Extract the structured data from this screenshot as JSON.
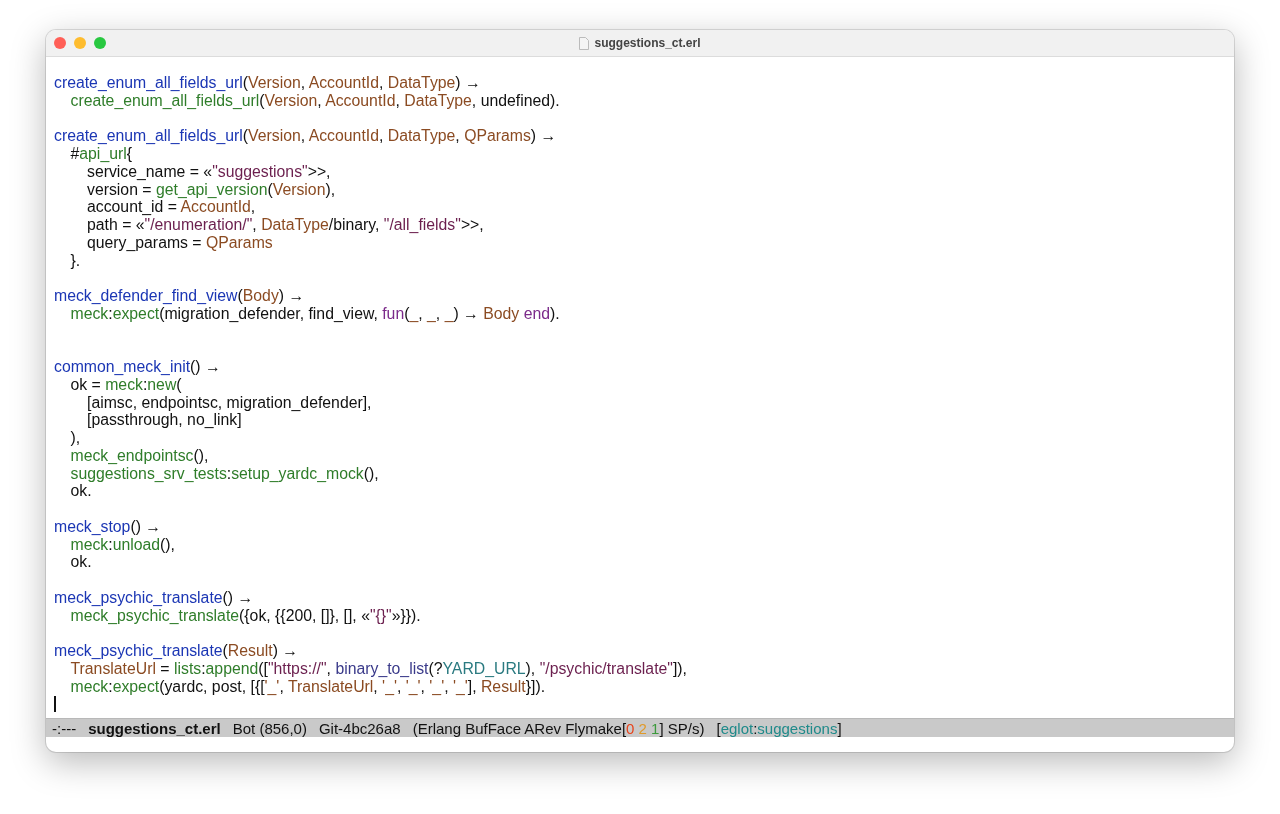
{
  "window": {
    "title": "suggestions_ct.erl"
  },
  "lines": [
    {
      "kind": "code",
      "tokens": [
        {
          "text": "create_enum_all_fields_url",
          "kind": "def"
        },
        {
          "text": "(",
          "kind": "p"
        },
        {
          "text": "Version",
          "kind": "var"
        },
        {
          "text": ", ",
          "kind": "p"
        },
        {
          "text": "AccountId",
          "kind": "var"
        },
        {
          "text": ", ",
          "kind": "p"
        },
        {
          "text": "DataType",
          "kind": "var"
        },
        {
          "text": ") →",
          "kind": "p"
        }
      ],
      "children": [
        {
          "kind": "code",
          "tokens": [
            {
              "text": "create_enum_all_fields_url",
              "kind": "call"
            },
            {
              "text": "(",
              "kind": "p"
            },
            {
              "text": "Version",
              "kind": "var"
            },
            {
              "text": ", ",
              "kind": "p"
            },
            {
              "text": "AccountId",
              "kind": "var"
            },
            {
              "text": ", ",
              "kind": "p"
            },
            {
              "text": "DataType",
              "kind": "var"
            },
            {
              "text": ", undefined).",
              "kind": "p"
            }
          ]
        }
      ]
    },
    {
      "kind": "blank"
    },
    {
      "kind": "code",
      "tokens": [
        {
          "text": "create_enum_all_fields_url",
          "kind": "def"
        },
        {
          "text": "(",
          "kind": "p"
        },
        {
          "text": "Version",
          "kind": "var"
        },
        {
          "text": ", ",
          "kind": "p"
        },
        {
          "text": "AccountId",
          "kind": "var"
        },
        {
          "text": ", ",
          "kind": "p"
        },
        {
          "text": "DataType",
          "kind": "var"
        },
        {
          "text": ", ",
          "kind": "p"
        },
        {
          "text": "QParams",
          "kind": "var"
        },
        {
          "text": ") →",
          "kind": "p"
        }
      ],
      "children": [
        {
          "kind": "code",
          "tokens": [
            {
              "text": "#",
              "kind": "p"
            },
            {
              "text": "api_url",
              "kind": "call"
            },
            {
              "text": "{",
              "kind": "p"
            }
          ],
          "children": [
            {
              "kind": "code",
              "tokens": [
                {
                  "text": "service_name = «",
                  "kind": "p"
                },
                {
                  "text": "\"suggestions\"",
                  "kind": "str"
                },
                {
                  "text": ">>,",
                  "kind": "p"
                }
              ]
            },
            {
              "kind": "code",
              "tokens": [
                {
                  "text": "version = ",
                  "kind": "p"
                },
                {
                  "text": "get_api_version",
                  "kind": "call"
                },
                {
                  "text": "(",
                  "kind": "p"
                },
                {
                  "text": "Version",
                  "kind": "var"
                },
                {
                  "text": "),",
                  "kind": "p"
                }
              ]
            },
            {
              "kind": "code",
              "tokens": [
                {
                  "text": "account_id = ",
                  "kind": "p"
                },
                {
                  "text": "AccountId",
                  "kind": "var"
                },
                {
                  "text": ",",
                  "kind": "p"
                }
              ]
            },
            {
              "kind": "code",
              "tokens": [
                {
                  "text": "path = «",
                  "kind": "p"
                },
                {
                  "text": "\"/enumeration/\"",
                  "kind": "str"
                },
                {
                  "text": ", ",
                  "kind": "p"
                },
                {
                  "text": "DataType",
                  "kind": "var"
                },
                {
                  "text": "/binary, ",
                  "kind": "p"
                },
                {
                  "text": "\"/all_fields\"",
                  "kind": "str"
                },
                {
                  "text": ">>,",
                  "kind": "p"
                }
              ]
            },
            {
              "kind": "code",
              "tokens": [
                {
                  "text": "query_params = ",
                  "kind": "p"
                },
                {
                  "text": "QParams",
                  "kind": "var"
                }
              ]
            }
          ]
        },
        {
          "kind": "code",
          "tokens": [
            {
              "text": "}.",
              "kind": "p"
            }
          ]
        }
      ]
    },
    {
      "kind": "blank"
    },
    {
      "kind": "code",
      "tokens": [
        {
          "text": "meck_defender_find_view",
          "kind": "def"
        },
        {
          "text": "(",
          "kind": "p"
        },
        {
          "text": "Body",
          "kind": "var"
        },
        {
          "text": ") →",
          "kind": "p"
        }
      ],
      "children": [
        {
          "kind": "code",
          "tokens": [
            {
              "text": "meck",
              "kind": "call"
            },
            {
              "text": ":",
              "kind": "p"
            },
            {
              "text": "expect",
              "kind": "call"
            },
            {
              "text": "(migration_defender, find_view, ",
              "kind": "p"
            },
            {
              "text": "fun",
              "kind": "kw"
            },
            {
              "text": "(",
              "kind": "p"
            },
            {
              "text": "_",
              "kind": "var"
            },
            {
              "text": ", ",
              "kind": "p"
            },
            {
              "text": "_",
              "kind": "var"
            },
            {
              "text": ", ",
              "kind": "p"
            },
            {
              "text": "_",
              "kind": "var"
            },
            {
              "text": ") → ",
              "kind": "p"
            },
            {
              "text": "Body ",
              "kind": "var"
            },
            {
              "text": "end",
              "kind": "kw"
            },
            {
              "text": ").",
              "kind": "p"
            }
          ]
        }
      ]
    },
    {
      "kind": "blank"
    },
    {
      "kind": "blank"
    },
    {
      "kind": "code",
      "tokens": [
        {
          "text": "common_meck_init",
          "kind": "def"
        },
        {
          "text": "() →",
          "kind": "p"
        }
      ],
      "children": [
        {
          "kind": "code",
          "tokens": [
            {
              "text": "ok = ",
              "kind": "p"
            },
            {
              "text": "meck",
              "kind": "call"
            },
            {
              "text": ":",
              "kind": "p"
            },
            {
              "text": "new",
              "kind": "call"
            },
            {
              "text": "(",
              "kind": "p"
            }
          ],
          "children": [
            {
              "kind": "code",
              "tokens": [
                {
                  "text": "[aimsc, endpointsc, migration_defender],",
                  "kind": "p"
                }
              ]
            },
            {
              "kind": "code",
              "tokens": [
                {
                  "text": "[passthrough, no_link]",
                  "kind": "p"
                }
              ]
            }
          ]
        },
        {
          "kind": "code",
          "tokens": [
            {
              "text": "),",
              "kind": "p"
            }
          ]
        },
        {
          "kind": "code",
          "tokens": [
            {
              "text": "meck_endpointsc",
              "kind": "call"
            },
            {
              "text": "(),",
              "kind": "p"
            }
          ]
        },
        {
          "kind": "code",
          "tokens": [
            {
              "text": "suggestions_srv_tests",
              "kind": "call"
            },
            {
              "text": ":",
              "kind": "p"
            },
            {
              "text": "setup_yardc_mock",
              "kind": "call"
            },
            {
              "text": "(),",
              "kind": "p"
            }
          ]
        },
        {
          "kind": "code",
          "tokens": [
            {
              "text": "ok.",
              "kind": "p"
            }
          ]
        }
      ]
    },
    {
      "kind": "blank"
    },
    {
      "kind": "code",
      "tokens": [
        {
          "text": "meck_stop",
          "kind": "def"
        },
        {
          "text": "() →",
          "kind": "p"
        }
      ],
      "children": [
        {
          "kind": "code",
          "tokens": [
            {
              "text": "meck",
              "kind": "call"
            },
            {
              "text": ":",
              "kind": "p"
            },
            {
              "text": "unload",
              "kind": "call"
            },
            {
              "text": "(),",
              "kind": "p"
            }
          ]
        },
        {
          "kind": "code",
          "tokens": [
            {
              "text": "ok.",
              "kind": "p"
            }
          ]
        }
      ]
    },
    {
      "kind": "blank"
    },
    {
      "kind": "code",
      "tokens": [
        {
          "text": "meck_psychic_translate",
          "kind": "def"
        },
        {
          "text": "() →",
          "kind": "p"
        }
      ],
      "children": [
        {
          "kind": "code",
          "tokens": [
            {
              "text": "meck_psychic_translate",
              "kind": "call"
            },
            {
              "text": "({ok, {{200, []}, [], «",
              "kind": "p"
            },
            {
              "text": "\"{}\"",
              "kind": "str"
            },
            {
              "text": "»}}).",
              "kind": "p"
            }
          ]
        }
      ]
    },
    {
      "kind": "blank"
    },
    {
      "kind": "code",
      "tokens": [
        {
          "text": "meck_psychic_translate",
          "kind": "def"
        },
        {
          "text": "(",
          "kind": "p"
        },
        {
          "text": "Result",
          "kind": "var"
        },
        {
          "text": ") →",
          "kind": "p"
        }
      ],
      "children": [
        {
          "kind": "code",
          "tokens": [
            {
              "text": "TranslateUrl",
              "kind": "var"
            },
            {
              "text": " = ",
              "kind": "p"
            },
            {
              "text": "lists",
              "kind": "call"
            },
            {
              "text": ":",
              "kind": "p"
            },
            {
              "text": "append",
              "kind": "call"
            },
            {
              "text": "([",
              "kind": "p"
            },
            {
              "text": "\"https://\"",
              "kind": "str"
            },
            {
              "text": ", ",
              "kind": "p"
            },
            {
              "text": "binary_to_list",
              "kind": "fn"
            },
            {
              "text": "(?",
              "kind": "p"
            },
            {
              "text": "YARD_URL",
              "kind": "macro"
            },
            {
              "text": "), ",
              "kind": "p"
            },
            {
              "text": "\"/psychic/translate\"",
              "kind": "str"
            },
            {
              "text": "]),",
              "kind": "p"
            }
          ]
        },
        {
          "kind": "code",
          "tokens": [
            {
              "text": "meck",
              "kind": "call"
            },
            {
              "text": ":",
              "kind": "p"
            },
            {
              "text": "expect",
              "kind": "call"
            },
            {
              "text": "(yardc, post, [{[",
              "kind": "p"
            },
            {
              "text": "'_'",
              "kind": "var"
            },
            {
              "text": ", ",
              "kind": "p"
            },
            {
              "text": "TranslateUrl",
              "kind": "var"
            },
            {
              "text": ", ",
              "kind": "p"
            },
            {
              "text": "'_'",
              "kind": "var"
            },
            {
              "text": ", ",
              "kind": "p"
            },
            {
              "text": "'_'",
              "kind": "var"
            },
            {
              "text": ", ",
              "kind": "p"
            },
            {
              "text": "'_'",
              "kind": "var"
            },
            {
              "text": ", ",
              "kind": "p"
            },
            {
              "text": "'_'",
              "kind": "var"
            },
            {
              "text": "], ",
              "kind": "p"
            },
            {
              "text": "Result",
              "kind": "var"
            },
            {
              "text": "}]).",
              "kind": "p"
            }
          ]
        }
      ]
    }
  ],
  "mode_line": {
    "status": "-:---",
    "buffer": "suggestions_ct.erl",
    "position": "Bot (856,0)",
    "vc": "Git-4bc26a8",
    "modes": [
      {
        "text": "(Erlang BufFace ARev Flymake[",
        "kind": "p"
      },
      {
        "text": "0 ",
        "kind": "err"
      },
      {
        "text": "2 ",
        "kind": "warn"
      },
      {
        "text": "1",
        "kind": "note"
      },
      {
        "text": "] SP/s)",
        "kind": "p"
      }
    ],
    "lsp": [
      {
        "text": "[",
        "kind": "p"
      },
      {
        "text": "eglot",
        "kind": "lsp"
      },
      {
        "text": ":",
        "kind": "p"
      },
      {
        "text": "suggestions",
        "kind": "lsp"
      },
      {
        "text": "]",
        "kind": "p"
      }
    ]
  }
}
